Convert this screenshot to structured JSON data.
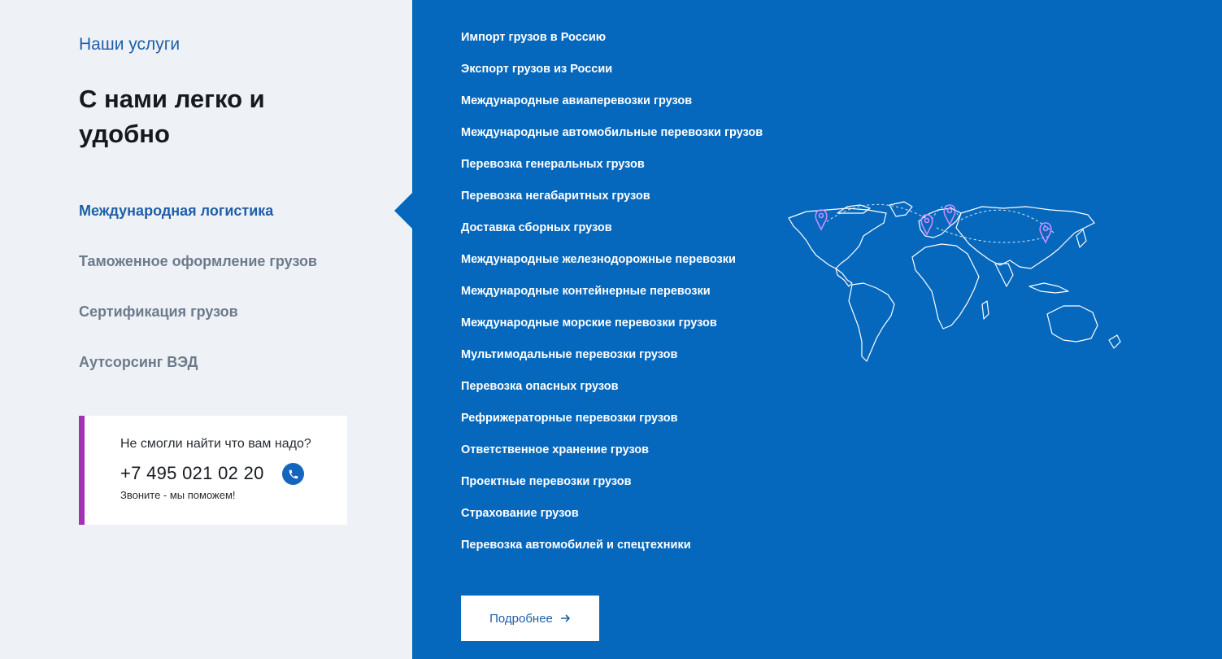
{
  "left": {
    "section_label": "Наши услуги",
    "headline": "С нами легко и удобно",
    "categories": [
      {
        "label": "Международная логистика",
        "active": true
      },
      {
        "label": "Таможенное оформление грузов",
        "active": false
      },
      {
        "label": "Сертификация грузов",
        "active": false
      },
      {
        "label": "Аутсорсинг ВЭД",
        "active": false
      }
    ],
    "help": {
      "question": "Не смогли найти что вам надо?",
      "phone": "+7 495 021 02 20",
      "subtitle": "Звоните - мы поможем!",
      "phone_icon": "phone-icon"
    }
  },
  "services": [
    "Импорт грузов в Россию",
    "Экспорт грузов из России",
    "Международные авиаперевозки грузов",
    "Международные автомобильные перевозки грузов",
    "Перевозка генеральных грузов",
    "Перевозка негабаритных грузов",
    "Доставка сборных грузов",
    "Международные железнодорожные перевозки",
    "Международные контейнерные перевозки",
    "Международные морские перевозки грузов",
    "Мультимодальные перевозки грузов",
    "Перевозка опасных грузов",
    "Рефрижераторные перевозки грузов",
    "Ответственное хранение грузов",
    "Проектные перевозки грузов",
    "Страхование грузов",
    "Перевозка автомобилей и спецтехники"
  ],
  "more_button": {
    "label": "Подробнее",
    "icon": "arrow-right-icon"
  },
  "colors": {
    "accent": "#1f5fa8",
    "panel_blue": "#0668bd",
    "card_stripe": "#a531b5",
    "pin": "#c98bff"
  }
}
